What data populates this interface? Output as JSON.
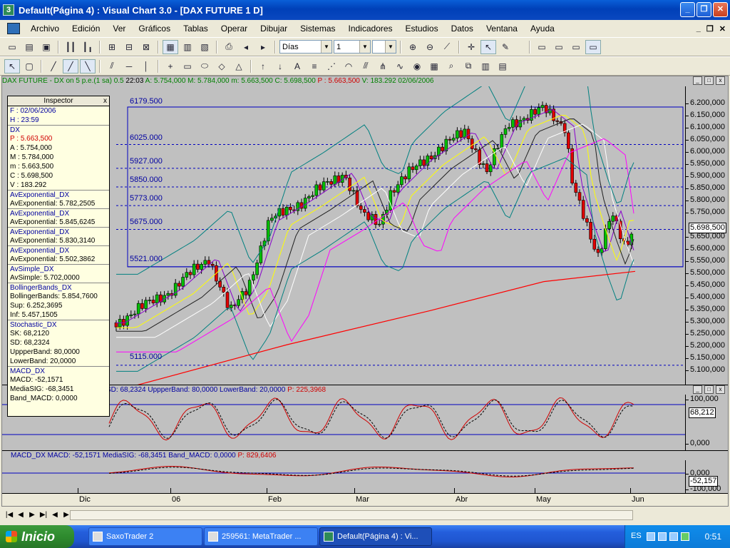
{
  "titlebar": {
    "app_icon": "3",
    "title": "Default(Página 4) : Visual Chart  3.0 - [DAX FUTURE 1 D]",
    "minimize": "_",
    "restore": "❐",
    "close": "✕"
  },
  "menu": {
    "items": [
      "Archivo",
      "Edición",
      "Ver",
      "Gráficos",
      "Tablas",
      "Operar",
      "Dibujar",
      "Sistemas",
      "Indicadores",
      "Estudios",
      "Datos",
      "Ventana",
      "Ayuda"
    ],
    "mdi_min": "_",
    "mdi_restore": "❐",
    "mdi_close": "✕"
  },
  "toolbar": {
    "period": "Días",
    "compression": "1"
  },
  "panes": {
    "price": {
      "header": {
        "symbol": "DAX FUTURE - DX on 5 p.e.(1 sa) 0.5",
        "time": "22:03",
        "open": "A: 5.754,000",
        "high": "M: 5.784,000",
        "low": "m: 5.663,500",
        "close": "C: 5.698,500",
        "p": "P : 5.663,500",
        "v": "V: 183.292",
        "date": "02/06/2006"
      },
      "yaxis": [
        "6.200,000",
        "6.150,000",
        "6.100,000",
        "6.050,000",
        "6.000,000",
        "5.950,000",
        "5.900,000",
        "5.850,000",
        "5.800,000",
        "5.750,000",
        "5.700,000",
        "5.650,000",
        "5.600,000",
        "5.550,000",
        "5.500,000",
        "5.450,000",
        "5.400,000",
        "5.350,000",
        "5.300,000",
        "5.250,000",
        "5.200,000",
        "5.150,000",
        "5.100,000"
      ],
      "current": "5.698,500",
      "levels": [
        "6179.500",
        "6025.000",
        "5927.000",
        "5850.000",
        "5773.000",
        "5675.000",
        "5521.000",
        "5115.000"
      ]
    },
    "stoch": {
      "header": "SD: 68,2324  UppperBand: 80,0000  LowerBand: 20,0000",
      "p": "P: 225,3968",
      "yaxis": [
        "100,000",
        "0,000"
      ],
      "current": "68,212"
    },
    "macd": {
      "header": "MACD_DX  MACD: -52,1571  MediaSIG: -68,3451  Band_MACD: 0,0000",
      "p": "P: 829,6406",
      "yaxis": [
        "0,000",
        "-100,000"
      ],
      "current": "-52,157"
    }
  },
  "inspector": {
    "title": "Inspector",
    "close": "x",
    "rows": [
      {
        "t": "F : 02/06/2006",
        "c": "blu"
      },
      {
        "t": "H : 23:59",
        "c": "blu"
      },
      {
        "t": "DX",
        "c": "sec"
      },
      {
        "t": "P : 5.663,500",
        "c": "red"
      },
      {
        "t": "A : 5.754,000",
        "c": ""
      },
      {
        "t": "M : 5.784,000",
        "c": ""
      },
      {
        "t": "m : 5.663,500",
        "c": ""
      },
      {
        "t": "C : 5.698,500",
        "c": ""
      },
      {
        "t": "V : 183.292",
        "c": ""
      },
      {
        "t": "AvExponential_DX",
        "c": "sec"
      },
      {
        "t": "AvExponential: 5.782,2505",
        "c": ""
      },
      {
        "t": "AvExponential_DX",
        "c": "sec"
      },
      {
        "t": "AvExponential: 5.845,6245",
        "c": ""
      },
      {
        "t": "AvExponential_DX",
        "c": "sec"
      },
      {
        "t": "AvExponential: 5.830,3140",
        "c": ""
      },
      {
        "t": "AvExponential_DX",
        "c": "sec"
      },
      {
        "t": "AvExponential: 5.502,3862",
        "c": ""
      },
      {
        "t": "AvSimple_DX",
        "c": "sec"
      },
      {
        "t": "AvSimple: 5.702,0000",
        "c": ""
      },
      {
        "t": "BollingerBands_DX",
        "c": "sec"
      },
      {
        "t": "BollingerBands: 5.854,7600",
        "c": ""
      },
      {
        "t": "Sup: 6.252,3695",
        "c": ""
      },
      {
        "t": "Inf: 5.457,1505",
        "c": ""
      },
      {
        "t": "Stochastic_DX",
        "c": "sec"
      },
      {
        "t": "SK: 68,2120",
        "c": ""
      },
      {
        "t": "SD: 68,2324",
        "c": ""
      },
      {
        "t": "UppperBand: 80,0000",
        "c": ""
      },
      {
        "t": "LowerBand: 20,0000",
        "c": ""
      },
      {
        "t": "MACD_DX",
        "c": "sec"
      },
      {
        "t": "MACD: -52,1571",
        "c": ""
      },
      {
        "t": "MediaSIG: -68,3451",
        "c": ""
      },
      {
        "t": "Band_MACD: 0,0000",
        "c": ""
      }
    ]
  },
  "timeaxis": [
    "Dic",
    "06",
    "Feb",
    "Mar",
    "Abr",
    "May",
    "Jun"
  ],
  "taskbar": {
    "start": "Inicio",
    "tasks": [
      "SaxoTrader 2",
      "259561: MetaTrader ...",
      "Default(Página 4) : Vi..."
    ],
    "lang": "ES",
    "clock": "0:51"
  },
  "colors": {
    "up": "#00C000",
    "down": "#E00000",
    "level": "#0000C0",
    "bollinger": "#008080",
    "ema_red": "#FF0000",
    "ema_mag": "#FF00FF",
    "ema_yel": "#FFFF00",
    "ema_white": "#FFFFFF"
  },
  "icons": [
    "app-icon",
    "minimize-icon",
    "restore-icon",
    "close-icon",
    "pointer-icon",
    "zoom-in-icon",
    "zoom-out-icon",
    "trendline-icon"
  ]
}
